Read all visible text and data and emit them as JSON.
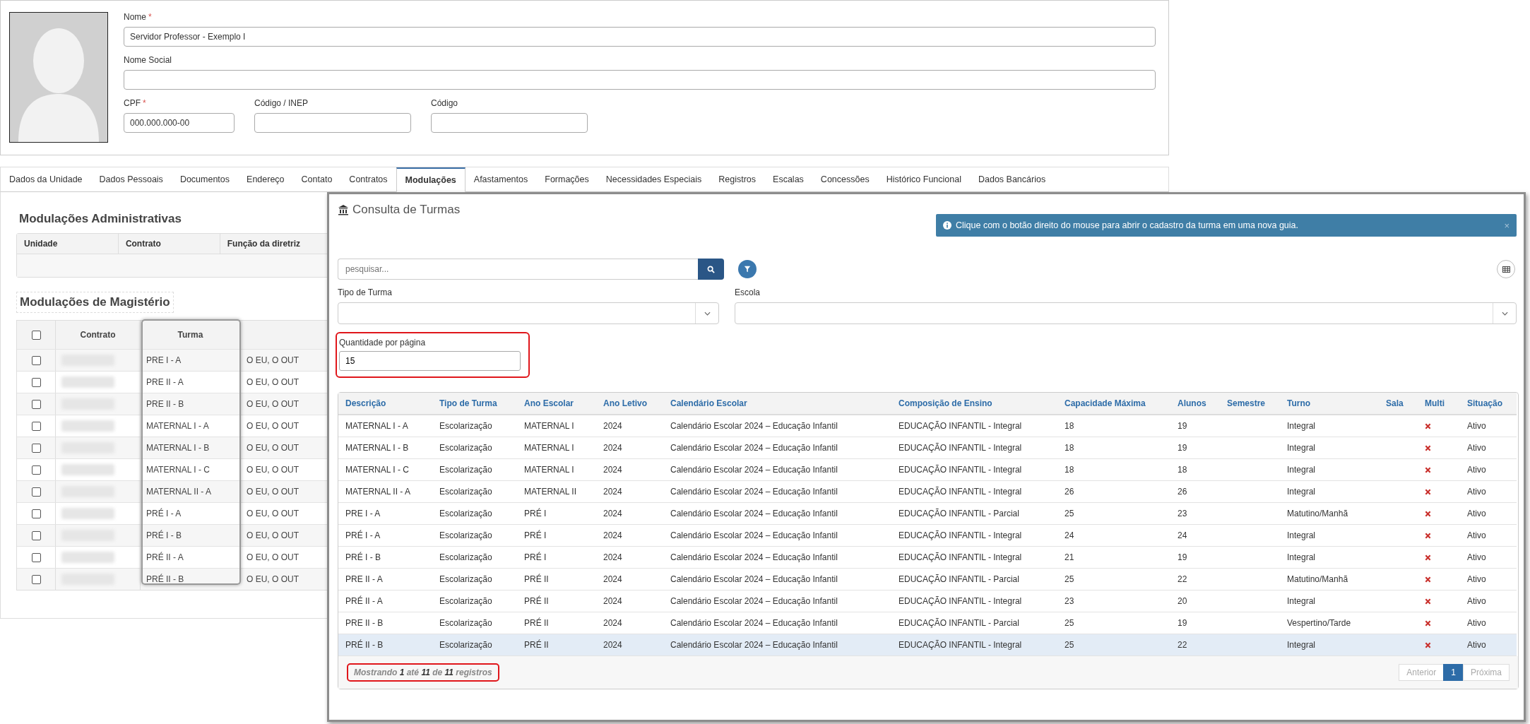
{
  "profile": {
    "fields_row1": [
      {
        "label": "Nome",
        "required_mark": "*",
        "value": "Servidor Professor - Exemplo I"
      }
    ],
    "fields_row2": [
      {
        "label": "Nome Social"
      }
    ],
    "fields_row3": [
      {
        "label": "CPF",
        "required_mark": "*",
        "value": "000.000.000-00"
      },
      {
        "label": "Código / INEP"
      },
      {
        "label": "Código"
      }
    ]
  },
  "tabs": [
    {
      "label": "Dados da Unidade",
      "selected": false
    },
    {
      "label": "Dados Pessoais",
      "selected": false
    },
    {
      "label": "Documentos",
      "selected": false
    },
    {
      "label": "Endereço",
      "selected": false
    },
    {
      "label": "Contato",
      "selected": false
    },
    {
      "label": "Contratos",
      "selected": false
    },
    {
      "label": "Modulações",
      "selected": true
    },
    {
      "label": "Afastamentos",
      "selected": false
    },
    {
      "label": "Formações",
      "selected": false
    },
    {
      "label": "Necessidades Especiais",
      "selected": false
    },
    {
      "label": "Registros",
      "selected": false
    },
    {
      "label": "Escalas",
      "selected": false
    },
    {
      "label": "Concessões",
      "selected": false
    },
    {
      "label": "Histórico Funcional",
      "selected": false
    },
    {
      "label": "Dados Bancários",
      "selected": false
    }
  ],
  "admin": {
    "title": "Modulações Administrativas",
    "columns": [
      "Unidade",
      "Contrato",
      "Função da diretriz"
    ]
  },
  "magisterio": {
    "title": "Modulações de Magistério",
    "header_checked": false,
    "columns": [
      "Contrato",
      "Turma"
    ],
    "turma_highlighted": true,
    "rows": [
      {
        "checked": false,
        "turma": "PRE I - A",
        "column_4": "O EU, O OUT"
      },
      {
        "checked": false,
        "turma": "PRE II - A",
        "column_4": "O EU, O OUT"
      },
      {
        "checked": false,
        "turma": "PRE II - B",
        "column_4": "O EU, O OUT"
      },
      {
        "checked": false,
        "turma": "MATERNAL I - A",
        "column_4": "O EU, O OUT"
      },
      {
        "checked": false,
        "turma": "MATERNAL I - B",
        "column_4": "O EU, O OUT"
      },
      {
        "checked": false,
        "turma": "MATERNAL I - C",
        "column_4": "O EU, O OUT"
      },
      {
        "checked": false,
        "turma": "MATERNAL II - A",
        "column_4": "O EU, O OUT"
      },
      {
        "checked": false,
        "turma": "PRÉ I - A",
        "column_4": "O EU, O OUT"
      },
      {
        "checked": false,
        "turma": "PRÉ I - B",
        "column_4": "O EU, O OUT"
      },
      {
        "checked": false,
        "turma": "PRÉ II - A",
        "column_4": "O EU, O OUT"
      },
      {
        "checked": false,
        "turma": "PRÉ II - B",
        "column_4": "O EU, O OUT"
      }
    ]
  },
  "modal": {
    "title": "Consulta de Turmas",
    "alert": {
      "text": "Clique com o botão direito do mouse para abrir o cadastro da turma em uma nova guia.",
      "close": "×"
    },
    "search": {
      "placeholder": "pesquisar..."
    },
    "tipo_de_turma": {
      "label": "Tipo de Turma"
    },
    "escola": {
      "label": "Escola"
    },
    "quantidade": {
      "label": "Quantidade por página",
      "value": "15",
      "highlighted": true
    },
    "table": {
      "columns": [
        "Descrição",
        "Tipo de Turma",
        "Ano Escolar",
        "Ano Letivo",
        "Calendário Escolar",
        "Composição de Ensino",
        "Capacidade Máxima",
        "Alunos",
        "Semestre",
        "Turno",
        "Sala",
        "Multi",
        "Situação"
      ],
      "rows": [
        {
          "descricao": "MATERNAL I - A",
          "tipo": "Escolarização",
          "ano_escolar": "MATERNAL I",
          "ano_letivo": "2024",
          "calendario": "Calendário Escolar 2024 – Educação Infantil",
          "composicao": "EDUCAÇÃO INFANTIL - Integral",
          "capacidade": "18",
          "alunos": "19",
          "turno": "Integral",
          "multi": false,
          "situacao": "Ativo",
          "selected": false
        },
        {
          "descricao": "MATERNAL I - B",
          "tipo": "Escolarização",
          "ano_escolar": "MATERNAL I",
          "ano_letivo": "2024",
          "calendario": "Calendário Escolar 2024 – Educação Infantil",
          "composicao": "EDUCAÇÃO INFANTIL - Integral",
          "capacidade": "18",
          "alunos": "19",
          "turno": "Integral",
          "multi": false,
          "situacao": "Ativo",
          "selected": false
        },
        {
          "descricao": "MATERNAL I - C",
          "tipo": "Escolarização",
          "ano_escolar": "MATERNAL I",
          "ano_letivo": "2024",
          "calendario": "Calendário Escolar 2024 – Educação Infantil",
          "composicao": "EDUCAÇÃO INFANTIL - Integral",
          "capacidade": "18",
          "alunos": "18",
          "turno": "Integral",
          "multi": false,
          "situacao": "Ativo",
          "selected": false
        },
        {
          "descricao": "MATERNAL II - A",
          "tipo": "Escolarização",
          "ano_escolar": "MATERNAL II",
          "ano_letivo": "2024",
          "calendario": "Calendário Escolar 2024 – Educação Infantil",
          "composicao": "EDUCAÇÃO INFANTIL - Integral",
          "capacidade": "26",
          "alunos": "26",
          "turno": "Integral",
          "multi": false,
          "situacao": "Ativo",
          "selected": false
        },
        {
          "descricao": "PRE I - A",
          "tipo": "Escolarização",
          "ano_escolar": "PRÉ I",
          "ano_letivo": "2024",
          "calendario": "Calendário Escolar 2024 – Educação Infantil",
          "composicao": "EDUCAÇÃO INFANTIL - Parcial",
          "capacidade": "25",
          "alunos": "23",
          "turno": "Matutino/Manhã",
          "multi": false,
          "situacao": "Ativo",
          "selected": false
        },
        {
          "descricao": "PRÉ I - A",
          "tipo": "Escolarização",
          "ano_escolar": "PRÉ I",
          "ano_letivo": "2024",
          "calendario": "Calendário Escolar 2024 – Educação Infantil",
          "composicao": "EDUCAÇÃO INFANTIL - Integral",
          "capacidade": "24",
          "alunos": "24",
          "turno": "Integral",
          "multi": false,
          "situacao": "Ativo",
          "selected": false
        },
        {
          "descricao": "PRÉ I - B",
          "tipo": "Escolarização",
          "ano_escolar": "PRÉ I",
          "ano_letivo": "2024",
          "calendario": "Calendário Escolar 2024 – Educação Infantil",
          "composicao": "EDUCAÇÃO INFANTIL - Integral",
          "capacidade": "21",
          "alunos": "19",
          "turno": "Integral",
          "multi": false,
          "situacao": "Ativo",
          "selected": false
        },
        {
          "descricao": "PRE II - A",
          "tipo": "Escolarização",
          "ano_escolar": "PRÉ II",
          "ano_letivo": "2024",
          "calendario": "Calendário Escolar 2024 – Educação Infantil",
          "composicao": "EDUCAÇÃO INFANTIL - Parcial",
          "capacidade": "25",
          "alunos": "22",
          "turno": "Matutino/Manhã",
          "multi": false,
          "situacao": "Ativo",
          "selected": false
        },
        {
          "descricao": "PRÉ II - A",
          "tipo": "Escolarização",
          "ano_escolar": "PRÉ II",
          "ano_letivo": "2024",
          "calendario": "Calendário Escolar 2024 – Educação Infantil",
          "composicao": "EDUCAÇÃO INFANTIL - Integral",
          "capacidade": "23",
          "alunos": "20",
          "turno": "Integral",
          "multi": false,
          "situacao": "Ativo",
          "selected": false
        },
        {
          "descricao": "PRE II - B",
          "tipo": "Escolarização",
          "ano_escolar": "PRÉ II",
          "ano_letivo": "2024",
          "calendario": "Calendário Escolar 2024 – Educação Infantil",
          "composicao": "EDUCAÇÃO INFANTIL - Parcial",
          "capacidade": "25",
          "alunos": "19",
          "turno": "Vespertino/Tarde",
          "multi": false,
          "situacao": "Ativo",
          "selected": false
        },
        {
          "descricao": "PRÉ II - B",
          "tipo": "Escolarização",
          "ano_escolar": "PRÉ II",
          "ano_letivo": "2024",
          "calendario": "Calendário Escolar 2024 – Educação Infantil",
          "composicao": "EDUCAÇÃO INFANTIL - Integral",
          "capacidade": "25",
          "alunos": "22",
          "turno": "Integral",
          "multi": false,
          "situacao": "Ativo",
          "selected": true
        }
      ]
    },
    "summary": {
      "text": "Mostrando **1** até **11** de **11** registros",
      "highlighted": true
    },
    "pagination": [
      {
        "label": "Anterior",
        "selected": false,
        "disabled": true
      },
      {
        "label": "1",
        "selected": true,
        "disabled": false
      },
      {
        "label": "Próxima",
        "selected": false,
        "disabled": true
      }
    ]
  }
}
